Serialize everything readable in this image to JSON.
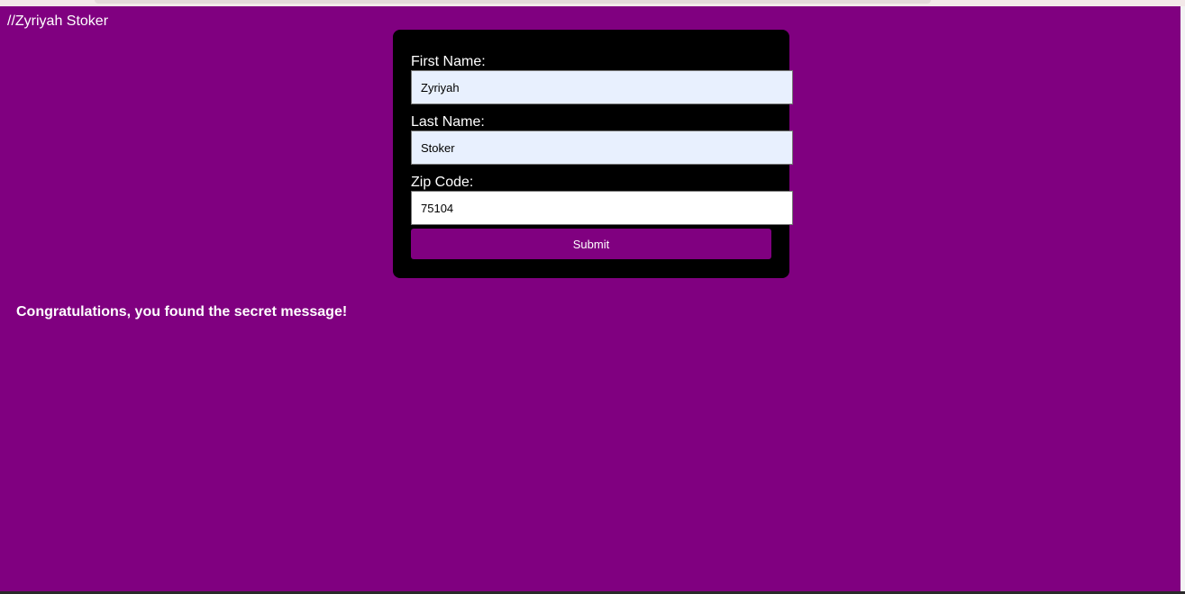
{
  "page": {
    "author_comment": "//Zyriyah Stoker",
    "secret_message": "Congratulations, you found the secret message!",
    "colors": {
      "page_background": "#800080",
      "card_background": "#000000",
      "submit_button": "#800080",
      "autofill_background": "#e8f0fe"
    }
  },
  "form": {
    "first_name": {
      "label": "First Name:",
      "value": "Zyriyah"
    },
    "last_name": {
      "label": "Last Name:",
      "value": "Stoker"
    },
    "zip_code": {
      "label": "Zip Code:",
      "value": "75104"
    },
    "submit_label": "Submit"
  }
}
